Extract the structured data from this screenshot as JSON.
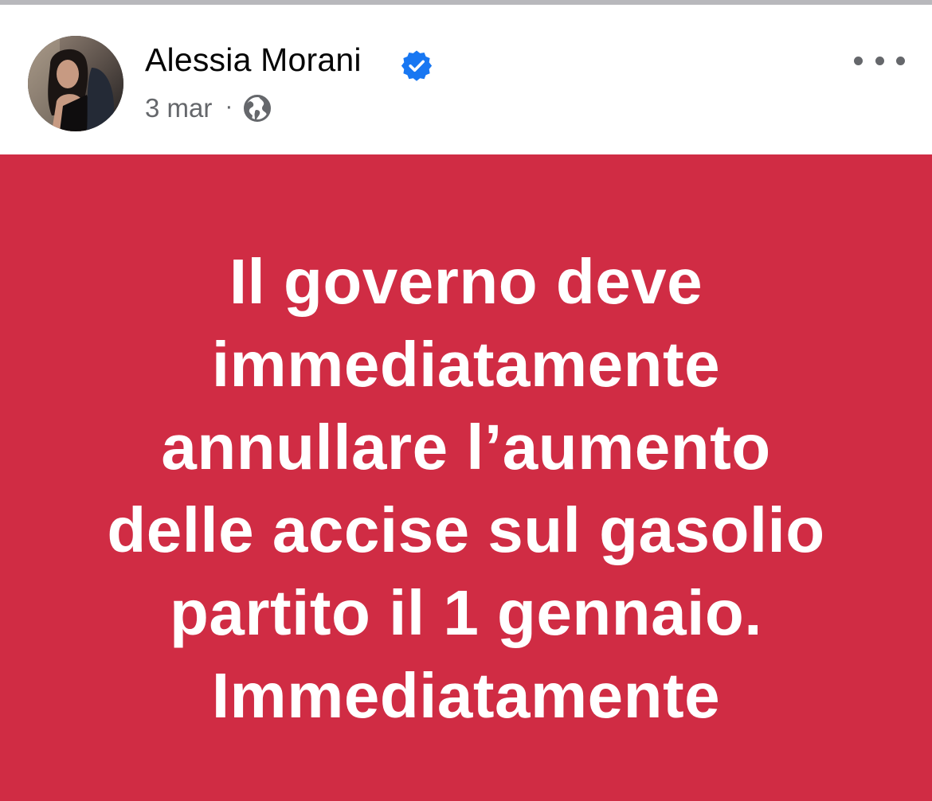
{
  "post": {
    "author_name": "Alessia Morani",
    "author_verified": true,
    "date": "3 mar",
    "meta_separator": "·",
    "audience_icon": "globe-icon",
    "menu_icon": "more-options-icon",
    "text": "Il governo deve\nimmediatamente\nannullare l’aumento\ndelle accise sul gasolio\npartito il 1 gennaio.\nImmediatamente",
    "background_color": "#d02c44",
    "text_color": "#ffffff"
  },
  "colors": {
    "verified_badge": "#1877f2",
    "secondary_text": "#65676b",
    "primary_text": "#050505"
  }
}
